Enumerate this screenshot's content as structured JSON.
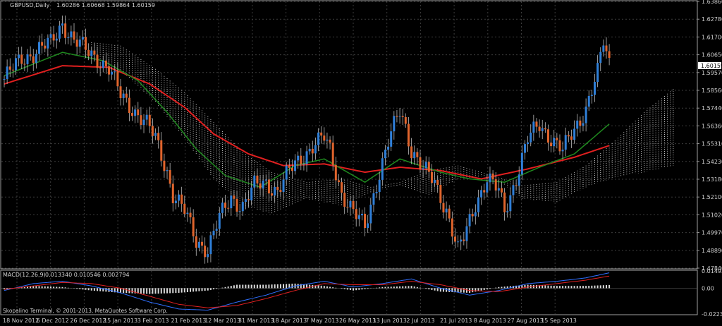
{
  "window": {
    "title": "GBPUSD,Daily",
    "ohlc_text": "1.60286 1.60668 1.59864 1.60159"
  },
  "indicator": {
    "title": "MACD(12,26,9)",
    "values_text": "0.013340 0.010546 0.002794"
  },
  "footer": {
    "copyright": "Skopalino Terminal, © 2001-2013, MetaQuotes Software Corp."
  },
  "colors": {
    "background": "#000000",
    "grid": "#3c3c3c",
    "frame": "#a0a0a0",
    "bull_candle": "#2f7fd8",
    "bear_candle": "#e0642c",
    "ma_fast": "#1f8a1f",
    "ma_slow": "#e11f1f",
    "cloud": "#d8a47c",
    "cloud_alt": "#e6e6e6",
    "macd_hist": "#d8d8d8",
    "macd_line": "#2f6fff",
    "signal_line": "#e02020"
  },
  "chart_data": [
    {
      "type": "candlestick",
      "title": "GBPUSD,Daily",
      "ylim": [
        1.4784,
        1.6386
      ],
      "y_ticks": [
        "1.63860",
        "1.62780",
        "1.61700",
        "1.60650",
        "1.59570",
        "1.58560",
        "1.57440",
        "1.56360",
        "1.55310",
        "1.54230",
        "1.53180",
        "1.52100",
        "1.51020",
        "1.49970",
        "1.48890",
        "1.47840"
      ],
      "current_price": "1.60159",
      "x_ticks": [
        "18 Nov 2012",
        "6 Dec 2012",
        "26 Dec 2012",
        "15 Jan 2013",
        "3 Feb 2013",
        "21 Feb 2013",
        "12 Mar 2013",
        "31 Mar 2013",
        "18 Apr 2013",
        "7 May 2013",
        "26 May 2013",
        "13 Jun 2013",
        "2 Jul 2013",
        "21 Jul 2013",
        "8 Aug 2013",
        "27 Aug 2013",
        "15 Sep 2013"
      ],
      "close_anchors": [
        [
          0,
          1.592
        ],
        [
          6,
          1.604
        ],
        [
          12,
          1.61
        ],
        [
          16,
          1.613
        ],
        [
          20,
          1.626
        ],
        [
          24,
          1.615
        ],
        [
          28,
          1.609
        ],
        [
          32,
          1.605
        ],
        [
          36,
          1.598
        ],
        [
          40,
          1.582
        ],
        [
          44,
          1.575
        ],
        [
          48,
          1.567
        ],
        [
          52,
          1.556
        ],
        [
          56,
          1.537
        ],
        [
          58,
          1.523
        ],
        [
          62,
          1.512
        ],
        [
          66,
          1.495
        ],
        [
          70,
          1.49
        ],
        [
          74,
          1.508
        ],
        [
          78,
          1.521
        ],
        [
          82,
          1.516
        ],
        [
          86,
          1.527
        ],
        [
          90,
          1.53
        ],
        [
          94,
          1.525
        ],
        [
          98,
          1.536
        ],
        [
          102,
          1.545
        ],
        [
          106,
          1.552
        ],
        [
          110,
          1.556
        ],
        [
          112,
          1.549
        ],
        [
          116,
          1.524
        ],
        [
          120,
          1.511
        ],
        [
          124,
          1.503
        ],
        [
          128,
          1.53
        ],
        [
          132,
          1.553
        ],
        [
          136,
          1.573
        ],
        [
          138,
          1.564
        ],
        [
          140,
          1.55
        ],
        [
          144,
          1.537
        ],
        [
          148,
          1.53
        ],
        [
          152,
          1.514
        ],
        [
          156,
          1.488
        ],
        [
          158,
          1.496
        ],
        [
          162,
          1.518
        ],
        [
          166,
          1.532
        ],
        [
          170,
          1.524
        ],
        [
          172,
          1.513
        ],
        [
          176,
          1.533
        ],
        [
          180,
          1.555
        ],
        [
          184,
          1.565
        ],
        [
          188,
          1.557
        ],
        [
          192,
          1.548
        ],
        [
          196,
          1.562
        ],
        [
          200,
          1.575
        ],
        [
          204,
          1.595
        ],
        [
          206,
          1.614
        ],
        [
          208,
          1.6016
        ]
      ],
      "ma_slow_anchors": [
        [
          0,
          1.589
        ],
        [
          20,
          1.6
        ],
        [
          36,
          1.599
        ],
        [
          50,
          1.589
        ],
        [
          62,
          1.575
        ],
        [
          72,
          1.559
        ],
        [
          84,
          1.547
        ],
        [
          96,
          1.54
        ],
        [
          110,
          1.541
        ],
        [
          124,
          1.536
        ],
        [
          136,
          1.539
        ],
        [
          150,
          1.537
        ],
        [
          164,
          1.532
        ],
        [
          180,
          1.538
        ],
        [
          196,
          1.545
        ],
        [
          208,
          1.552
        ]
      ],
      "ma_fast_anchors": [
        [
          0,
          1.594
        ],
        [
          20,
          1.608
        ],
        [
          34,
          1.603
        ],
        [
          46,
          1.591
        ],
        [
          56,
          1.572
        ],
        [
          66,
          1.55
        ],
        [
          76,
          1.534
        ],
        [
          88,
          1.527
        ],
        [
          100,
          1.54
        ],
        [
          110,
          1.544
        ],
        [
          124,
          1.53
        ],
        [
          136,
          1.544
        ],
        [
          150,
          1.536
        ],
        [
          160,
          1.532
        ],
        [
          172,
          1.53
        ],
        [
          184,
          1.539
        ],
        [
          196,
          1.547
        ],
        [
          208,
          1.565
        ]
      ],
      "cloud_a_anchors": [
        [
          30,
          1.614
        ],
        [
          40,
          1.612
        ],
        [
          52,
          1.598
        ],
        [
          62,
          1.584
        ],
        [
          72,
          1.566
        ],
        [
          82,
          1.548
        ],
        [
          92,
          1.536
        ],
        [
          104,
          1.53
        ],
        [
          116,
          1.532
        ],
        [
          126,
          1.527
        ],
        [
          136,
          1.53
        ],
        [
          146,
          1.537
        ],
        [
          156,
          1.54
        ],
        [
          168,
          1.534
        ],
        [
          178,
          1.528
        ],
        [
          190,
          1.53
        ],
        [
          200,
          1.54
        ],
        [
          210,
          1.555
        ],
        [
          220,
          1.572
        ],
        [
          230,
          1.586
        ]
      ],
      "cloud_b_anchors": [
        [
          30,
          1.604
        ],
        [
          40,
          1.597
        ],
        [
          52,
          1.578
        ],
        [
          62,
          1.556
        ],
        [
          72,
          1.532
        ],
        [
          82,
          1.516
        ],
        [
          92,
          1.511
        ],
        [
          104,
          1.52
        ],
        [
          116,
          1.516
        ],
        [
          126,
          1.524
        ],
        [
          136,
          1.528
        ],
        [
          146,
          1.522
        ],
        [
          156,
          1.532
        ],
        [
          168,
          1.534
        ],
        [
          178,
          1.52
        ],
        [
          190,
          1.518
        ],
        [
          200,
          1.527
        ],
        [
          210,
          1.533
        ],
        [
          220,
          1.536
        ],
        [
          230,
          1.54
        ]
      ],
      "bars": 209
    },
    {
      "type": "macd",
      "title": "MACD(12,26,9)",
      "ylim": [
        -0.02234,
        0.01493
      ],
      "y_ticks": [
        "0.01493",
        "0.00",
        "-0.02234"
      ],
      "macd_anchors": [
        [
          0,
          -0.002
        ],
        [
          10,
          0.004
        ],
        [
          20,
          0.006
        ],
        [
          30,
          0.002
        ],
        [
          40,
          -0.004
        ],
        [
          50,
          -0.012
        ],
        [
          60,
          -0.018
        ],
        [
          70,
          -0.019
        ],
        [
          80,
          -0.012
        ],
        [
          90,
          -0.006
        ],
        [
          100,
          0.002
        ],
        [
          110,
          0.006
        ],
        [
          120,
          0.001
        ],
        [
          130,
          0.004
        ],
        [
          140,
          0.008
        ],
        [
          150,
          0.0
        ],
        [
          160,
          -0.006
        ],
        [
          170,
          -0.002
        ],
        [
          180,
          0.004
        ],
        [
          190,
          0.006
        ],
        [
          200,
          0.009
        ],
        [
          208,
          0.01334
        ]
      ],
      "signal_anchors": [
        [
          0,
          -0.001
        ],
        [
          10,
          0.002
        ],
        [
          20,
          0.005
        ],
        [
          30,
          0.004
        ],
        [
          40,
          0.0
        ],
        [
          50,
          -0.007
        ],
        [
          60,
          -0.014
        ],
        [
          70,
          -0.017
        ],
        [
          80,
          -0.015
        ],
        [
          90,
          -0.009
        ],
        [
          100,
          -0.002
        ],
        [
          110,
          0.004
        ],
        [
          120,
          0.003
        ],
        [
          130,
          0.003
        ],
        [
          140,
          0.006
        ],
        [
          150,
          0.003
        ],
        [
          160,
          -0.002
        ],
        [
          170,
          -0.003
        ],
        [
          180,
          0.001
        ],
        [
          190,
          0.004
        ],
        [
          200,
          0.007
        ],
        [
          208,
          0.010546
        ]
      ]
    }
  ]
}
